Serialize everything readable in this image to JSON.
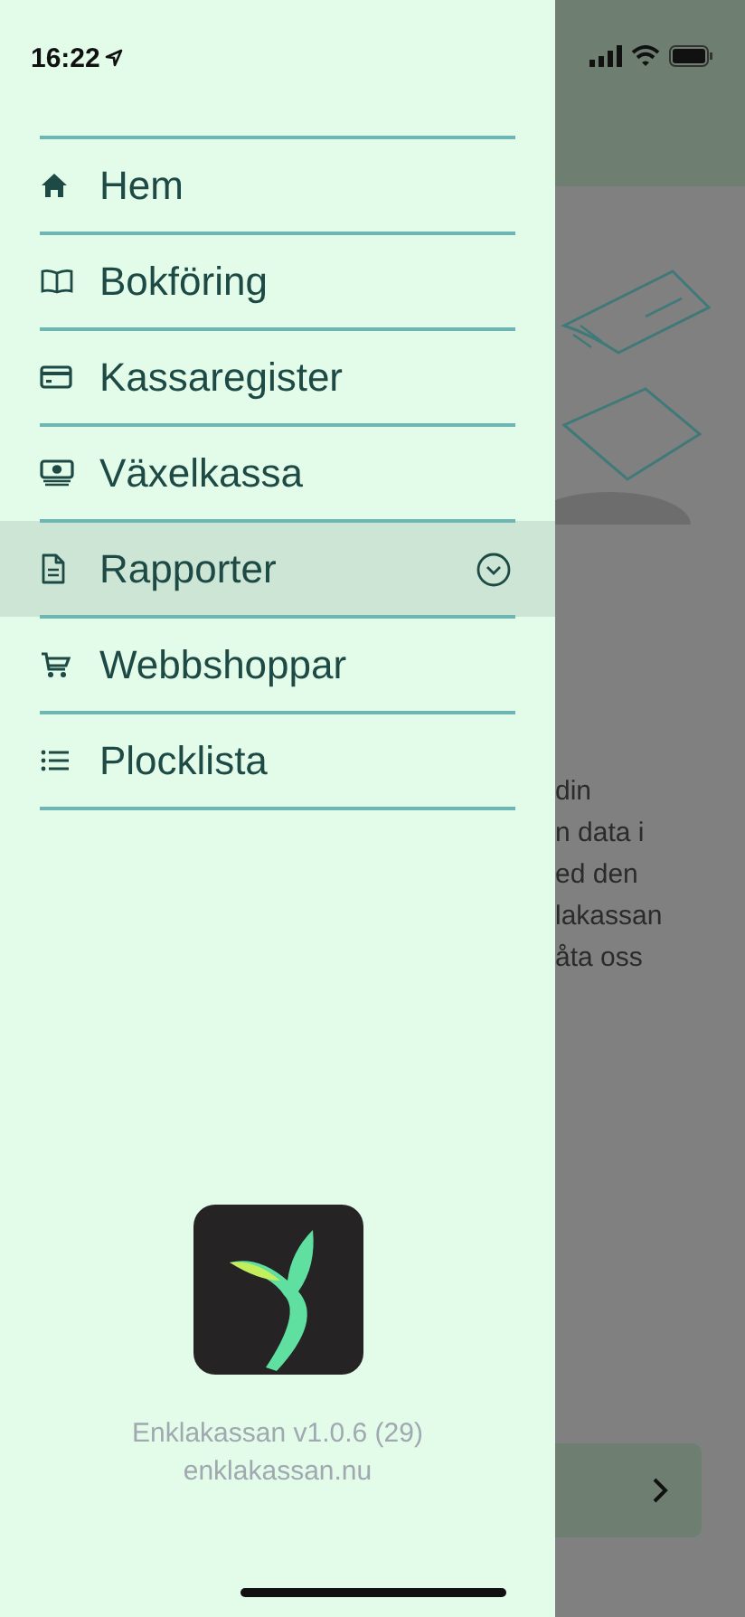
{
  "status_bar": {
    "time": "16:22"
  },
  "menu": {
    "items": [
      {
        "label": "Hem",
        "kind": "home",
        "selected": false,
        "expandable": false
      },
      {
        "label": "Bokföring",
        "kind": "book",
        "selected": false,
        "expandable": false
      },
      {
        "label": "Kassaregister",
        "kind": "card",
        "selected": false,
        "expandable": false
      },
      {
        "label": "Växelkassa",
        "kind": "money",
        "selected": false,
        "expandable": false
      },
      {
        "label": "Rapporter",
        "kind": "document",
        "selected": true,
        "expandable": true
      },
      {
        "label": "Webbshoppar",
        "kind": "cart",
        "selected": false,
        "expandable": false
      },
      {
        "label": "Plocklista",
        "kind": "list",
        "selected": false,
        "expandable": false
      }
    ]
  },
  "footer": {
    "version": "Enklakassan v1.0.6 (29)",
    "website": "enklakassan.nu"
  },
  "background_page": {
    "text_lines": [
      "din",
      "n data i",
      "ed den",
      "lakassan",
      "åta oss"
    ]
  }
}
